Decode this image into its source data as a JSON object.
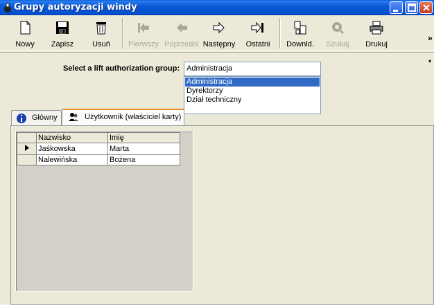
{
  "window": {
    "title": "Grupy autoryzacji windy",
    "controls": [
      "minimize",
      "maximize",
      "close"
    ]
  },
  "toolbar": {
    "items": [
      {
        "label": "Nowy",
        "icon": "new-document-icon",
        "enabled": true
      },
      {
        "label": "Zapisz",
        "icon": "floppy-disk-icon",
        "enabled": true
      },
      {
        "label": "Usuń",
        "icon": "trash-bin-icon",
        "enabled": true
      },
      {
        "label": "Pierwszy",
        "icon": "first-record-icon",
        "enabled": false
      },
      {
        "label": "Poprzedni",
        "icon": "previous-record-icon",
        "enabled": false
      },
      {
        "label": "Następny",
        "icon": "next-record-icon",
        "enabled": true
      },
      {
        "label": "Ostatni",
        "icon": "last-record-icon",
        "enabled": true
      },
      {
        "label": "Downld.",
        "icon": "download-icon",
        "enabled": true
      },
      {
        "label": "Szukaj",
        "icon": "search-icon",
        "enabled": false
      },
      {
        "label": "Drukuj",
        "icon": "printer-icon",
        "enabled": true
      }
    ],
    "overflow": "»"
  },
  "group_select": {
    "label": "Select a lift authorization group:",
    "value": "Administracja",
    "options": [
      "Administracja",
      "Dyrektorzy",
      "Dział techniczny"
    ],
    "selected_index": 0
  },
  "tabs": [
    {
      "label": "Główny",
      "icon": "info-icon",
      "active": false
    },
    {
      "label": "Użytkownik (właściciel karty)",
      "icon": "users-icon",
      "active": true
    }
  ],
  "grid": {
    "columns": [
      "Nazwisko",
      "Imię"
    ],
    "rows": [
      {
        "current": true,
        "cells": [
          "Jaśkowska",
          "Marta"
        ]
      },
      {
        "current": false,
        "cells": [
          "Nalewińska",
          "Bożena"
        ]
      }
    ]
  },
  "colors": {
    "titlebar": "#0450cf",
    "selection": "#316ac5",
    "window_bg": "#ece9d8",
    "active_tab_accent": "#e68b2c"
  }
}
